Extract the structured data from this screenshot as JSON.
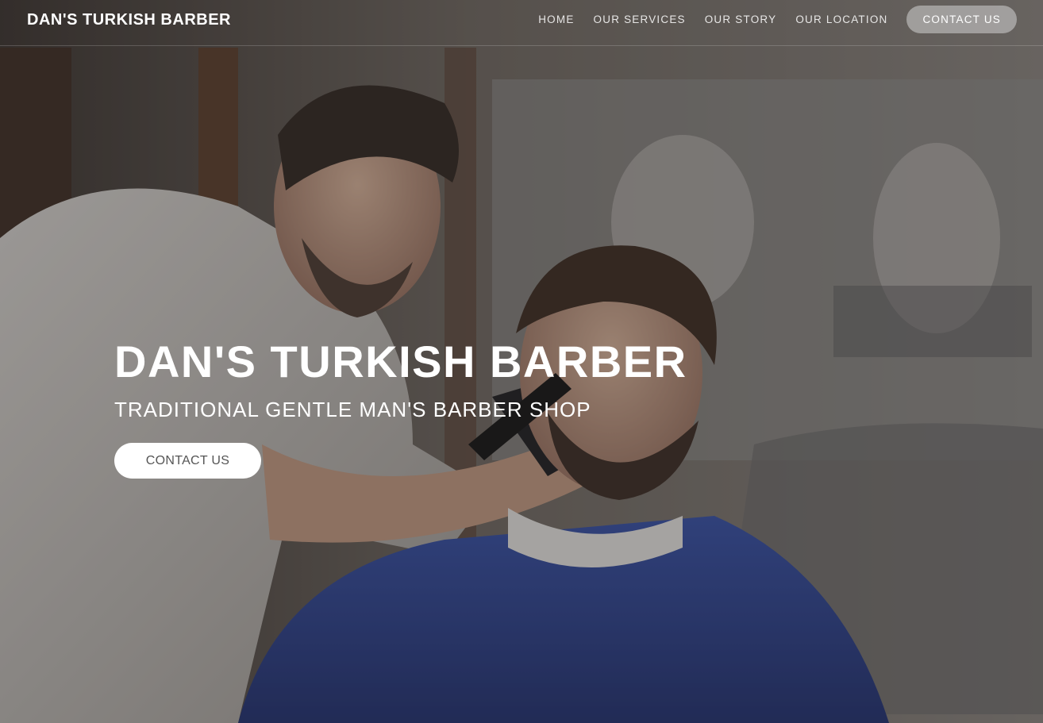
{
  "navbar": {
    "brand": "DAN'S TURKISH BARBER",
    "links": [
      {
        "label": "HOME"
      },
      {
        "label": "OUR SERVICES"
      },
      {
        "label": "OUR STORY"
      },
      {
        "label": "OUR LOCATION"
      }
    ],
    "cta_label": "CONTACT US"
  },
  "hero": {
    "title": "DAN'S TURKISH BARBER",
    "subtitle": "TRADITIONAL GENTLE MAN'S BARBER SHOP",
    "cta_label": "CONTACT US",
    "background_image": "barber-cutting-customer-hair-photo"
  },
  "colors": {
    "cape_blue": "#2a3f8f",
    "button_white": "#ffffff",
    "nav_cta_bg": "#a9a9a9"
  }
}
